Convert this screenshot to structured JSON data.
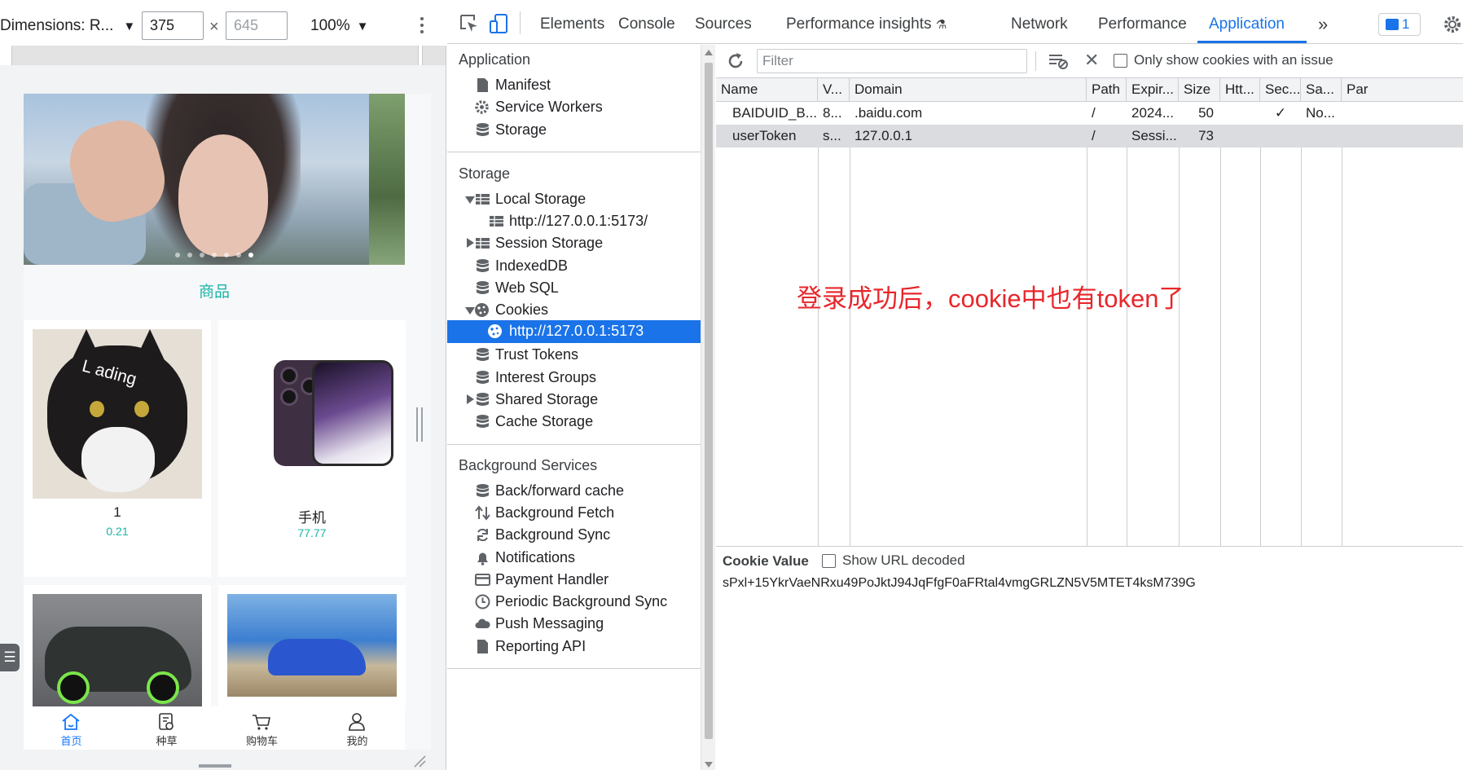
{
  "device_toolbar": {
    "dimensions_label": "Dimensions: R...",
    "width_value": "375",
    "height_placeholder": "645",
    "times": "×",
    "zoom": "100%"
  },
  "mobile_app": {
    "banner_dots": 7,
    "section_title": "商品",
    "products": [
      {
        "name": "1",
        "price": "0.21",
        "image": "cat-loading-photo"
      },
      {
        "name": "手机",
        "price": "77.77",
        "image": "iphone-photo"
      },
      {
        "name": "",
        "price": "",
        "image": "black-sports-car-photo"
      },
      {
        "name": "",
        "price": "",
        "image": "blue-convertible-photo"
      }
    ],
    "cat_overlay_text": "L  ading",
    "tabbar": [
      {
        "label": "首页",
        "icon": "home-icon",
        "active": true
      },
      {
        "label": "种草",
        "icon": "notes-icon",
        "active": false
      },
      {
        "label": "购物车",
        "icon": "cart-icon",
        "active": false
      },
      {
        "label": "我的",
        "icon": "user-icon",
        "active": false
      }
    ],
    "float_button_icon": "menu-icon"
  },
  "devtools": {
    "tabs": [
      "Elements",
      "Console",
      "Sources",
      "Performance insights",
      "Network",
      "Performance",
      "Application"
    ],
    "active_tab": "Application",
    "more_tabs": "»",
    "issues_count": "1",
    "sidebar": {
      "application_heading": "Application",
      "application_items": [
        "Manifest",
        "Service Workers",
        "Storage"
      ],
      "storage_heading": "Storage",
      "storage_items": {
        "local_storage": "Local Storage",
        "local_storage_child": "http://127.0.0.1:5173/",
        "session_storage": "Session Storage",
        "indexeddb": "IndexedDB",
        "web_sql": "Web SQL",
        "cookies": "Cookies",
        "cookies_child": "http://127.0.0.1:5173",
        "trust_tokens": "Trust Tokens",
        "interest_groups": "Interest Groups",
        "shared_storage": "Shared Storage",
        "cache_storage": "Cache Storage"
      },
      "background_heading": "Background Services",
      "background_items": [
        "Back/forward cache",
        "Background Fetch",
        "Background Sync",
        "Notifications",
        "Payment Handler",
        "Periodic Background Sync",
        "Push Messaging",
        "Reporting API"
      ]
    },
    "cookies": {
      "filter_placeholder": "Filter",
      "only_issue_label": "Only show cookies with an issue",
      "columns": [
        "Name",
        "V...",
        "Domain",
        "Path",
        "Expir...",
        "Size",
        "Htt...",
        "Sec...",
        "Sa...",
        "Par"
      ],
      "rows": [
        {
          "name": "BAIDUID_B...",
          "value": "8...",
          "domain": ".baidu.com",
          "path": "/",
          "expires": "2024...",
          "size": "50",
          "httponly": "",
          "secure": "✓",
          "samesite": "No...",
          "selected": false
        },
        {
          "name": "userToken",
          "value": "s...",
          "domain": "127.0.0.1",
          "path": "/",
          "expires": "Sessi...",
          "size": "73",
          "httponly": "",
          "secure": "",
          "samesite": "",
          "selected": true
        }
      ],
      "annotation": "登录成功后，cookie中也有token了",
      "cookie_value_title": "Cookie Value",
      "show_url_decoded": "Show URL decoded",
      "cookie_value": "sPxl+15YkrVaeNRxu49PoJktJ94JqFfgF0aFRtal4vmgGRLZN5V5MTET4ksM739G"
    }
  }
}
